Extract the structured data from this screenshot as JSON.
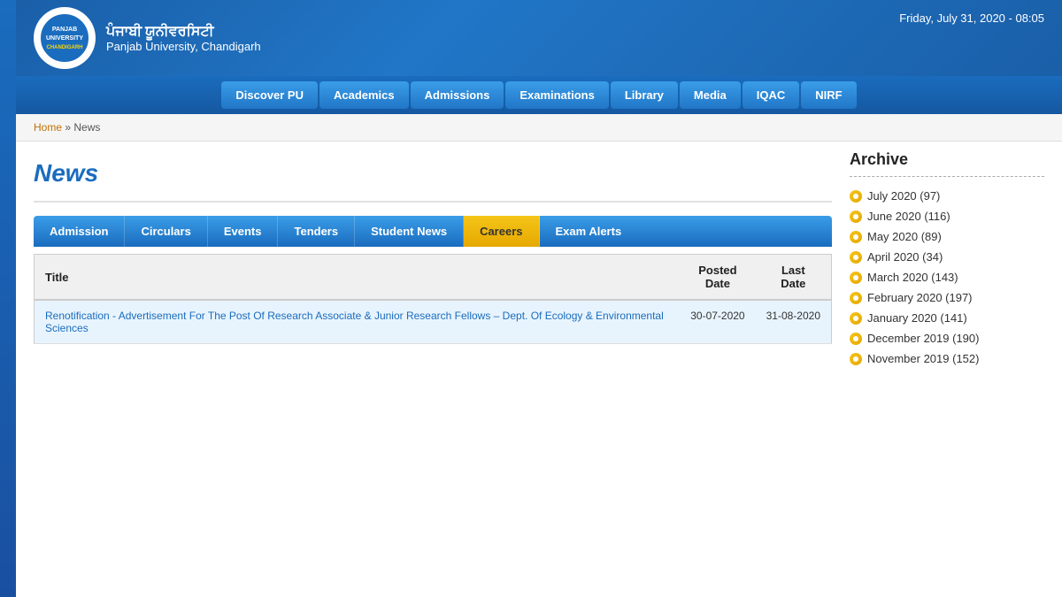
{
  "header": {
    "datetime": "Friday, July 31, 2020 - 08:05",
    "logo_text": "PU"
  },
  "nav": {
    "items": [
      {
        "label": "Discover PU"
      },
      {
        "label": "Academics"
      },
      {
        "label": "Admissions"
      },
      {
        "label": "Examinations"
      },
      {
        "label": "Library"
      },
      {
        "label": "Media"
      },
      {
        "label": "IQAC"
      },
      {
        "label": "NIRF"
      }
    ]
  },
  "breadcrumb": {
    "home": "Home",
    "separator": " » ",
    "current": "News"
  },
  "page": {
    "title": "News"
  },
  "tabs": [
    {
      "label": "Admission",
      "active": false
    },
    {
      "label": "Circulars",
      "active": false
    },
    {
      "label": "Events",
      "active": false
    },
    {
      "label": "Tenders",
      "active": false
    },
    {
      "label": "Student News",
      "active": false
    },
    {
      "label": "Careers",
      "active": true
    },
    {
      "label": "Exam Alerts",
      "active": false
    }
  ],
  "table": {
    "columns": [
      {
        "label": "Title",
        "key": "title"
      },
      {
        "label": "Posted Date",
        "key": "posted_date"
      },
      {
        "label": "Last Date",
        "key": "last_date"
      }
    ],
    "rows": [
      {
        "title": "Renotification - Advertisement For The Post Of Research Associate & Junior Research Fellows – Dept. Of Ecology & Environmental Sciences",
        "posted_date": "30-07-2020",
        "last_date": "31-08-2020"
      }
    ]
  },
  "sidebar": {
    "title": "Archive",
    "items": [
      {
        "label": "July 2020 (97)"
      },
      {
        "label": "June 2020 (116)"
      },
      {
        "label": "May 2020 (89)"
      },
      {
        "label": "April 2020 (34)"
      },
      {
        "label": "March 2020 (143)"
      },
      {
        "label": "February 2020 (197)"
      },
      {
        "label": "January 2020 (141)"
      },
      {
        "label": "December 2019 (190)"
      },
      {
        "label": "November 2019 (152)"
      }
    ]
  }
}
